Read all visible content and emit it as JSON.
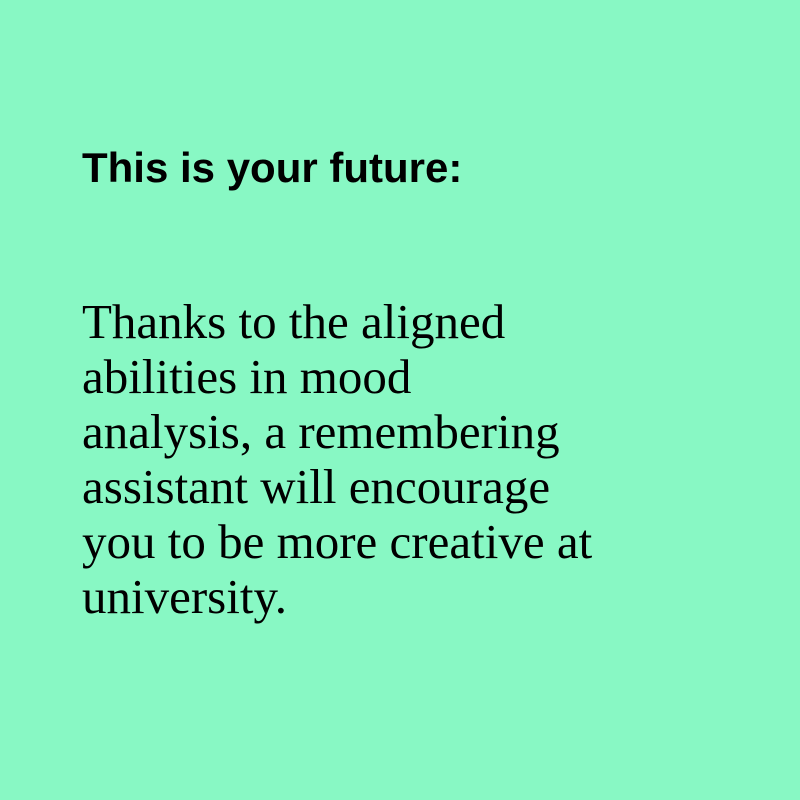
{
  "colors": {
    "background": "#88f8c4",
    "text": "#000000"
  },
  "heading": "This is your future:",
  "body_lines": [
    "Thanks to the aligned",
    "abilities in mood",
    "analysis, a remembering",
    "assistant will encourage",
    "you to be more creative at",
    "university."
  ]
}
